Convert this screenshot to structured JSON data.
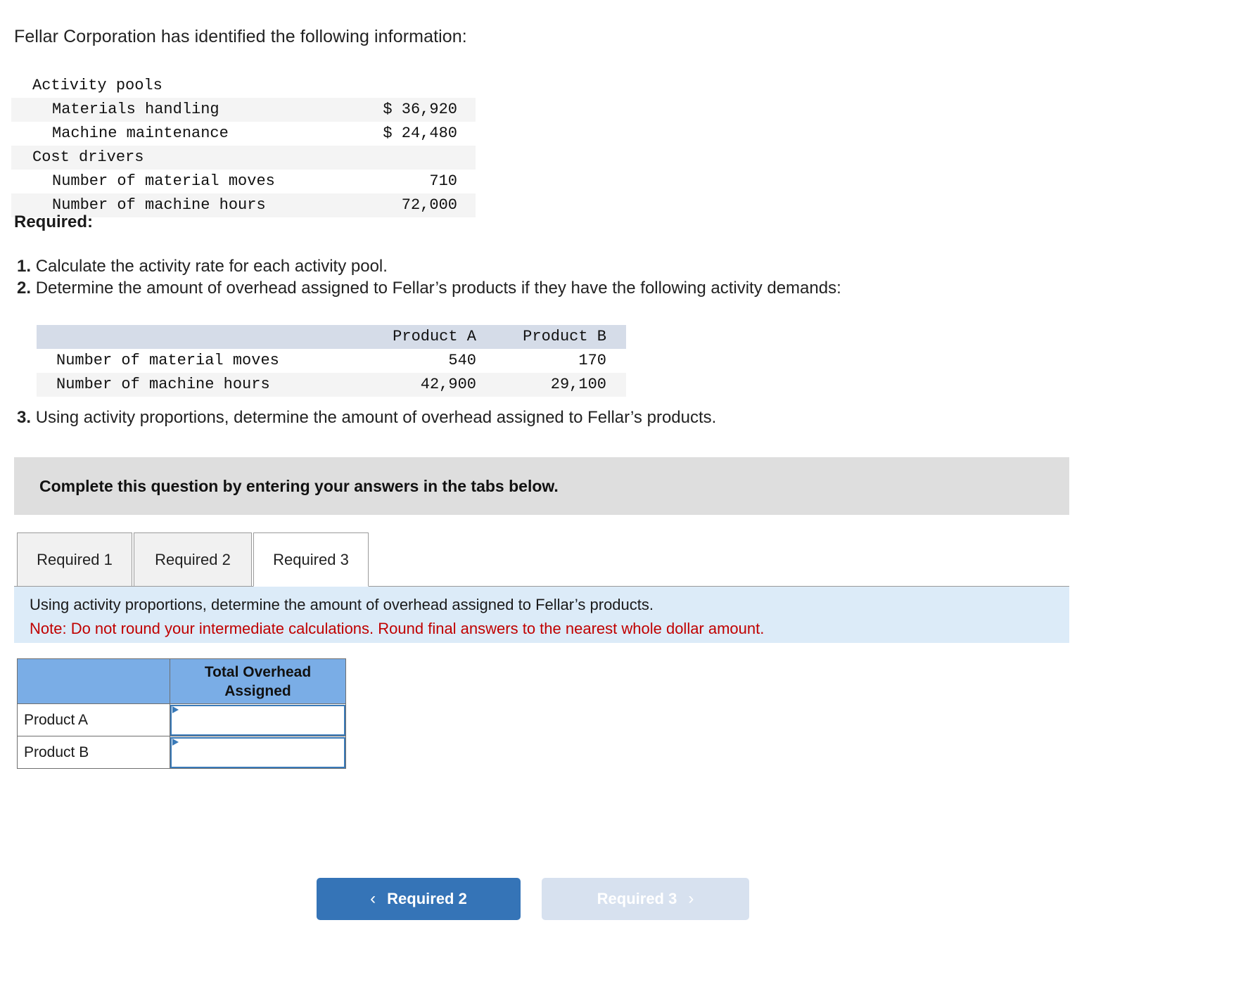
{
  "intro": "Fellar Corporation has identified the following information:",
  "facts_table": {
    "rows": [
      {
        "label": "Activity pools",
        "value": "",
        "indent": false,
        "shaded": false
      },
      {
        "label": "Materials handling",
        "value": "$ 36,920",
        "indent": true,
        "shaded": true
      },
      {
        "label": "Machine maintenance",
        "value": "$ 24,480",
        "indent": true,
        "shaded": false
      },
      {
        "label": "Cost drivers",
        "value": "",
        "indent": false,
        "shaded": true
      },
      {
        "label": "Number of material moves",
        "value": "710",
        "indent": true,
        "shaded": false
      },
      {
        "label": "Number of machine hours",
        "value": "72,000",
        "indent": true,
        "shaded": true
      }
    ]
  },
  "required": {
    "heading": "Required:",
    "items": [
      {
        "num": "1.",
        "text": "Calculate the activity rate for each activity pool."
      },
      {
        "num": "2.",
        "text": "Determine the amount of overhead assigned to Fellar’s products if they have the following activity demands:"
      },
      {
        "num": "3.",
        "text": "Using activity proportions, determine the amount of overhead assigned to Fellar’s products."
      }
    ]
  },
  "demand_table": {
    "headers": [
      "",
      "Product A",
      "Product B"
    ],
    "rows": [
      {
        "label": "Number of material moves",
        "a": "540",
        "b": "170",
        "shaded": false
      },
      {
        "label": "Number of machine hours",
        "a": "42,900",
        "b": "29,100",
        "shaded": true
      }
    ]
  },
  "banner": {
    "text": "Complete this question by entering your answers in the tabs below."
  },
  "tabs": [
    {
      "label": "Required 1",
      "active": false
    },
    {
      "label": "Required 2",
      "active": false
    },
    {
      "label": "Required 3",
      "active": true
    }
  ],
  "infobox": {
    "line1": "Using activity proportions, determine the amount of overhead assigned to Fellar’s products.",
    "line2": "Note: Do not round your intermediate calculations. Round final answers to the nearest whole dollar amount."
  },
  "answer_grid": {
    "corner_header": "",
    "column_header": "Total Overhead Assigned",
    "rows": [
      {
        "label": "Product A",
        "value": ""
      },
      {
        "label": "Product B",
        "value": ""
      }
    ]
  },
  "nav": {
    "prev_label": "Required 2",
    "next_label": "Required 3",
    "prev_chevron": "‹",
    "next_chevron": "›"
  },
  "colors": {
    "header_blue": "#7aade6",
    "primary_button": "#3574b7",
    "disabled_button": "#d7e1ef",
    "info_box": "#dcebf8",
    "banner_gray": "#dedede",
    "note_red": "#c00000",
    "row_shade": "#f4f4f4",
    "demand_header": "#d5dce8",
    "input_border": "#3a7ab8"
  }
}
